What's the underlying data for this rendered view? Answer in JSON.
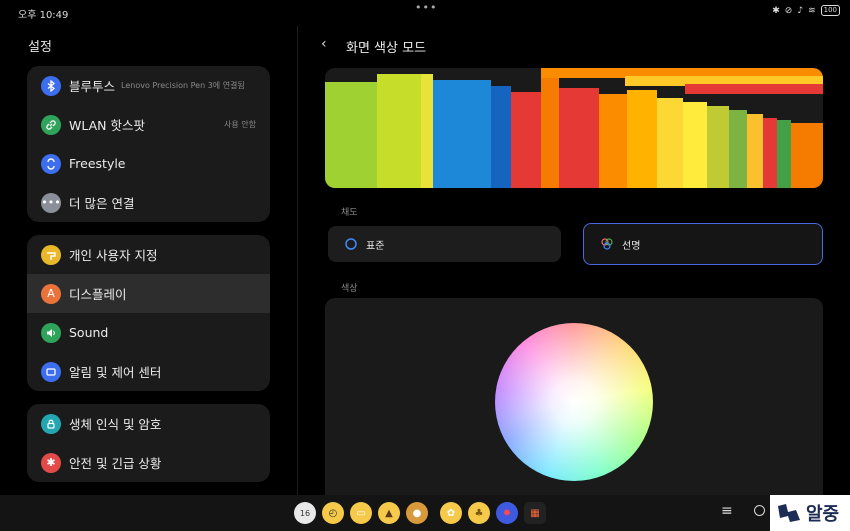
{
  "status": {
    "time": "오후 10:49",
    "dots": "•••",
    "battery": "100"
  },
  "sidebar": {
    "title": "설정",
    "groups": [
      {
        "items": [
          {
            "label": "블루투스",
            "sub": "Lenovo Precision Pen 3에 연결됨",
            "icon": "bluetooth-icon",
            "color": "#3d6ef0"
          },
          {
            "label": "WLAN 핫스팟",
            "right": "사용 안함",
            "icon": "link-icon",
            "color": "#2ea35a"
          },
          {
            "label": "Freestyle",
            "icon": "freestyle-icon",
            "color": "#3d6ef0"
          },
          {
            "label": "더 많은 연결",
            "icon": "more-icon",
            "color": "#8a8f99"
          }
        ]
      },
      {
        "items": [
          {
            "label": "개인 사용자 지정",
            "icon": "personalize-icon",
            "color": "#e8b82a"
          },
          {
            "label": "디스플레이",
            "icon": "display-icon",
            "color": "#e9733a",
            "active": true
          },
          {
            "label": "Sound",
            "icon": "sound-icon",
            "color": "#2ea35a"
          },
          {
            "label": "알림 및 제어 센터",
            "icon": "notification-icon",
            "color": "#3d6ef0"
          }
        ]
      },
      {
        "items": [
          {
            "label": "생체 인식 및 암호",
            "icon": "lock-icon",
            "color": "#23a6b0"
          },
          {
            "label": "안전 및 긴급 상황",
            "icon": "emergency-icon",
            "color": "#e24a4a"
          }
        ]
      }
    ]
  },
  "header": {
    "back": "‹",
    "title": "화면 색상 모드"
  },
  "saturation": {
    "label": "채도",
    "options": [
      {
        "label": "표준",
        "icon": "standard-icon"
      },
      {
        "label": "선명",
        "icon": "vivid-icon",
        "selected": true
      }
    ]
  },
  "hue": {
    "label": "색상"
  },
  "taskbar": {
    "apps": [
      {
        "name": "clock-app-icon",
        "color": "#e9e9e9",
        "glyph": "16"
      },
      {
        "name": "clock2-app-icon",
        "color": "#f5c949",
        "glyph": "◴"
      },
      {
        "name": "notes-app-icon",
        "color": "#f5c949",
        "glyph": "▭"
      },
      {
        "name": "gallery-app-icon",
        "color": "#f5c949",
        "glyph": "▲"
      },
      {
        "name": "recorder-app-icon",
        "color": "#d89a3a",
        "glyph": "●"
      },
      {
        "name": "flower-app-icon",
        "color": "#f5c949",
        "glyph": "✿"
      },
      {
        "name": "tree-app-icon",
        "color": "#f5c949",
        "glyph": "♣"
      },
      {
        "name": "settings-app-icon",
        "color": "#3d5ae0",
        "glyph": "✹"
      },
      {
        "name": "grid-app-icon",
        "color": "#222",
        "glyph": "▦"
      }
    ],
    "menu": "≡",
    "watermark": "알중"
  }
}
